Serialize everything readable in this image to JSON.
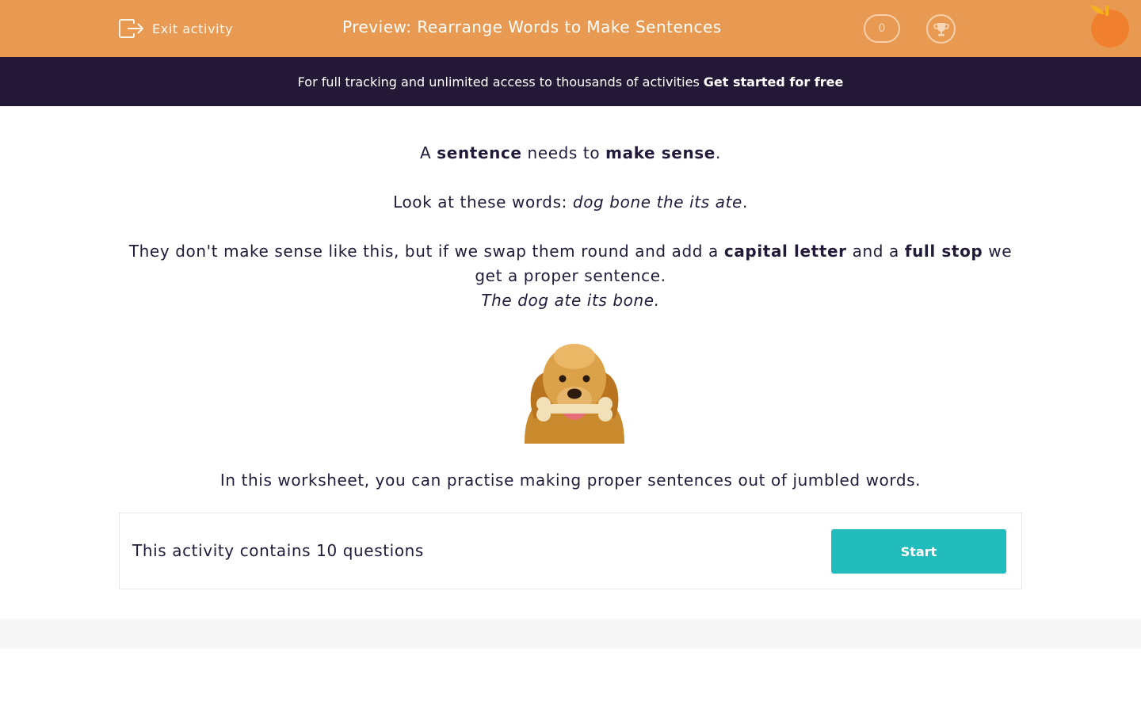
{
  "header": {
    "exit_label": "Exit activity",
    "title": "Preview: Rearrange Words to Make Sentences",
    "score": "0",
    "accent_color": "#e99a52"
  },
  "promo": {
    "text": "For full tracking and unlimited access to thousands of activities",
    "cta": "Get started for free"
  },
  "intro": {
    "p1": {
      "a": "A ",
      "b1": "sentence",
      "c": " needs to ",
      "b2": "make sense",
      "d": "."
    },
    "p2": {
      "a": "Look at these words: ",
      "i": "dog bone the its ate",
      "d": "."
    },
    "p3": {
      "a": "They don't make sense like this, but if we swap them round and add a ",
      "b1": "capital letter",
      "c": " and a ",
      "b2": "full stop",
      "d": " we get a proper sentence."
    },
    "p4": "The dog ate its bone.",
    "p5": "In this worksheet, you can practise making proper sentences out of jumbled words."
  },
  "activity": {
    "count_text": "This activity contains 10 questions",
    "start_label": "Start",
    "button_color": "#22bcbc"
  },
  "icons": [
    "exit-icon",
    "trophy-icon",
    "orange-logo-icon",
    "dog-image"
  ]
}
